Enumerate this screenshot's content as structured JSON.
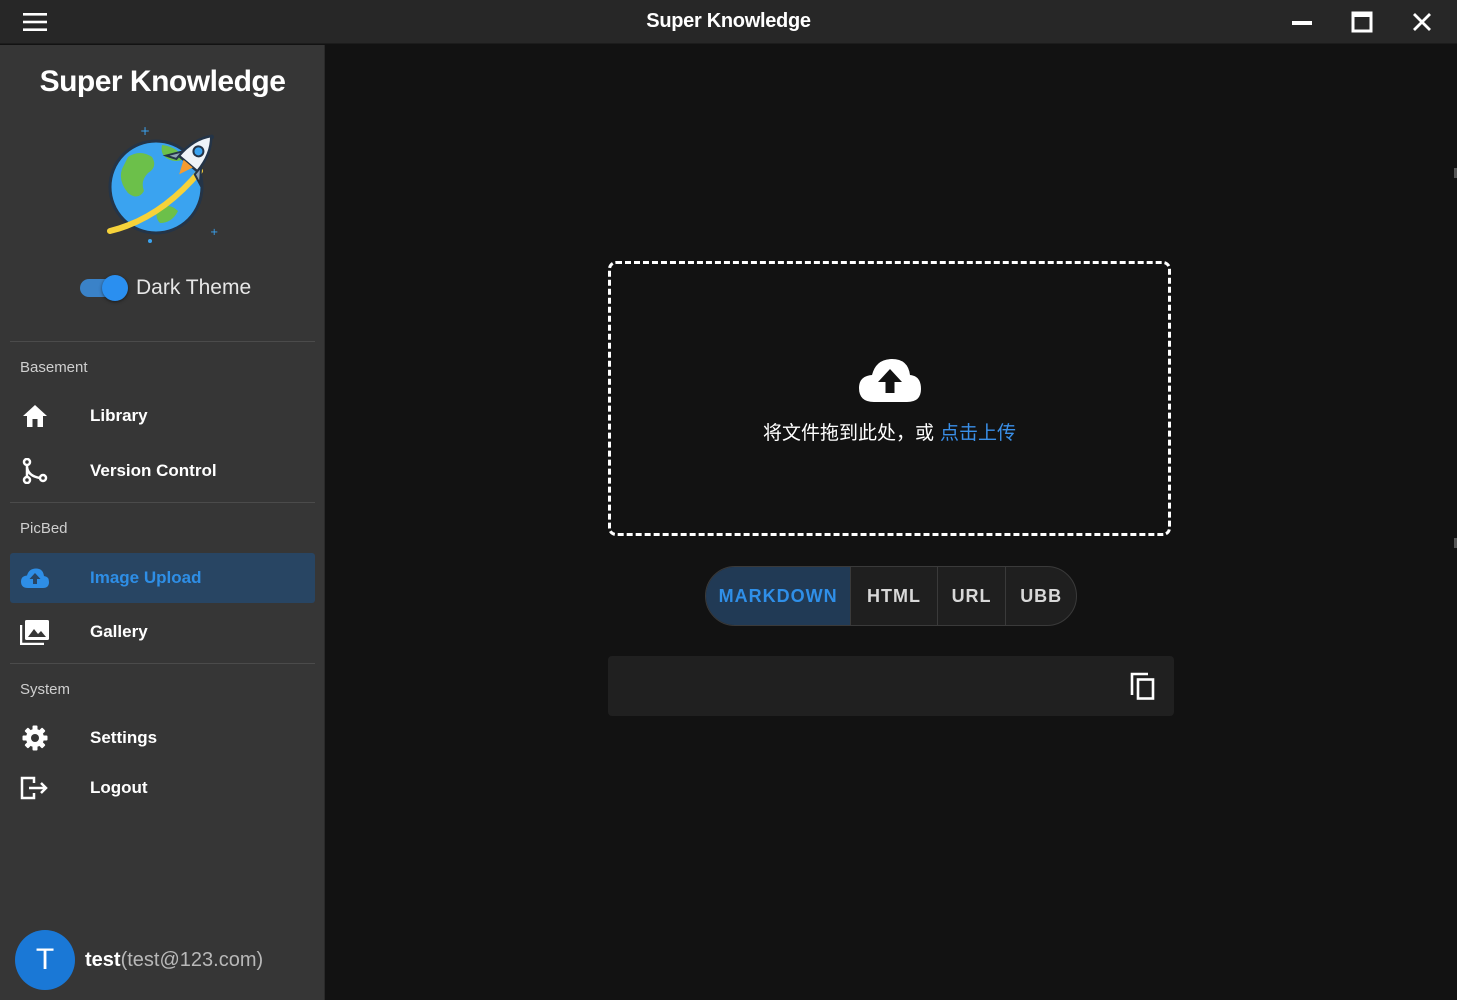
{
  "window": {
    "title": "Super Knowledge",
    "menu_icon": "hamburger-menu-icon",
    "controls": [
      "minimize-icon",
      "maximize-icon",
      "close-icon"
    ]
  },
  "sidebar": {
    "brand": "Super Knowledge",
    "logo": "globe-rocket-logo",
    "theme_toggle": {
      "label": "Dark Theme",
      "on": true
    },
    "sections": [
      {
        "label": "Basement",
        "items": [
          {
            "label": "Library",
            "icon": "home-icon"
          },
          {
            "label": "Version Control",
            "icon": "source-branch-icon"
          }
        ]
      },
      {
        "label": "PicBed",
        "items": [
          {
            "label": "Image Upload",
            "icon": "cloud-upload-icon",
            "active": true
          },
          {
            "label": "Gallery",
            "icon": "image-multiple-icon"
          }
        ]
      },
      {
        "label": "System",
        "items": [
          {
            "label": "Settings",
            "icon": "gear-icon"
          },
          {
            "label": "Logout",
            "icon": "logout-icon"
          }
        ]
      }
    ],
    "user": {
      "initial": "T",
      "name": "test",
      "email": "(test@123.com)"
    }
  },
  "upload": {
    "icon": "cloud-upload-icon",
    "text": "将文件拖到此处，或 ",
    "link": "点击上传"
  },
  "formats": {
    "options": [
      "MARKDOWN",
      "HTML",
      "URL",
      "UBB"
    ],
    "selected": "MARKDOWN"
  },
  "output": {
    "value": "",
    "copy_icon": "copy-icon"
  },
  "colors": {
    "accent": "#2e8ee6",
    "active_bg": "#284563",
    "sidebar_bg": "#363636",
    "main_bg": "#121212",
    "titlebar_bg": "#272727"
  }
}
